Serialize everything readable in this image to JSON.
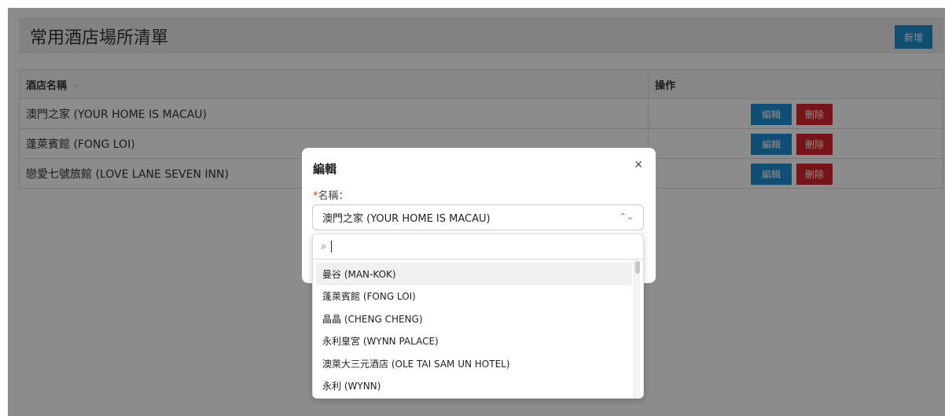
{
  "page": {
    "title": "常用酒店場所清單",
    "add_label": "新增"
  },
  "table": {
    "headers": {
      "name": "酒店名稱",
      "actions": "操作"
    },
    "rows": [
      {
        "name": "澳門之家 (YOUR HOME IS MACAU)",
        "edit": "編輯",
        "delete": "刪除"
      },
      {
        "name": "蓬萊賓館 (FONG LOI)",
        "edit": "編輯",
        "delete": "刪除"
      },
      {
        "name": "戀愛七號旅館 (LOVE LANE SEVEN INN)",
        "edit": "編輯",
        "delete": "刪除"
      }
    ]
  },
  "modal": {
    "title": "編輯",
    "required_mark": "*",
    "field_label": "名稱：",
    "selected_value": "澳門之家 (YOUR HOME IS MACAU)"
  },
  "dropdown": {
    "search_value": "",
    "options": [
      "曼谷 (MAN-KOK)",
      "蓬萊賓館 (FONG LOI)",
      "晶晶 (CHENG CHENG)",
      "永利皇宮 (WYNN PALACE)",
      "澳萊大三元酒店 (OLE TAI SAM UN HOTEL)",
      "永利 (WYNN)"
    ]
  },
  "colors": {
    "primary": "#1f8fd1",
    "danger": "#d9252b"
  }
}
